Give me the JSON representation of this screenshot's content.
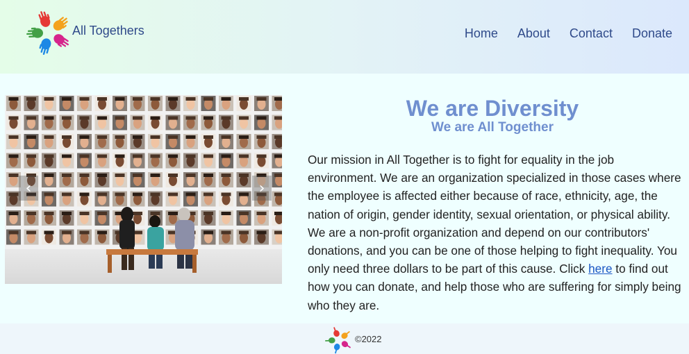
{
  "header": {
    "brand": "All Togethers",
    "nav": [
      "Home",
      "About",
      "Contact",
      "Donate"
    ]
  },
  "carousel": {
    "prev_symbol": "‹",
    "next_symbol": "›"
  },
  "content": {
    "title": "We are Diversity",
    "subtitle": "We are All Together",
    "paragraph_before_link": "Our mission in All Together is to fight for equality in the job environment. We are an organization specialized in those cases where the employee is affected either because of race, ethnicity, age, the nation of origin, gender identity, sexual orientation, or physical ability. We are a non-profit organization and depend on our contributors' donations, and you can be one of those helping to fight inequality. You only need three dollars to be part of this cause. Click ",
    "link_text": "here",
    "paragraph_after_link": " to find out how you can donate, and help those who are suffering for simply being who they are."
  },
  "footer": {
    "copyright": "©2022"
  },
  "colors": {
    "accent": "#6f8fcf",
    "nav": "#2f4a8a",
    "link": "#1a56c4"
  }
}
